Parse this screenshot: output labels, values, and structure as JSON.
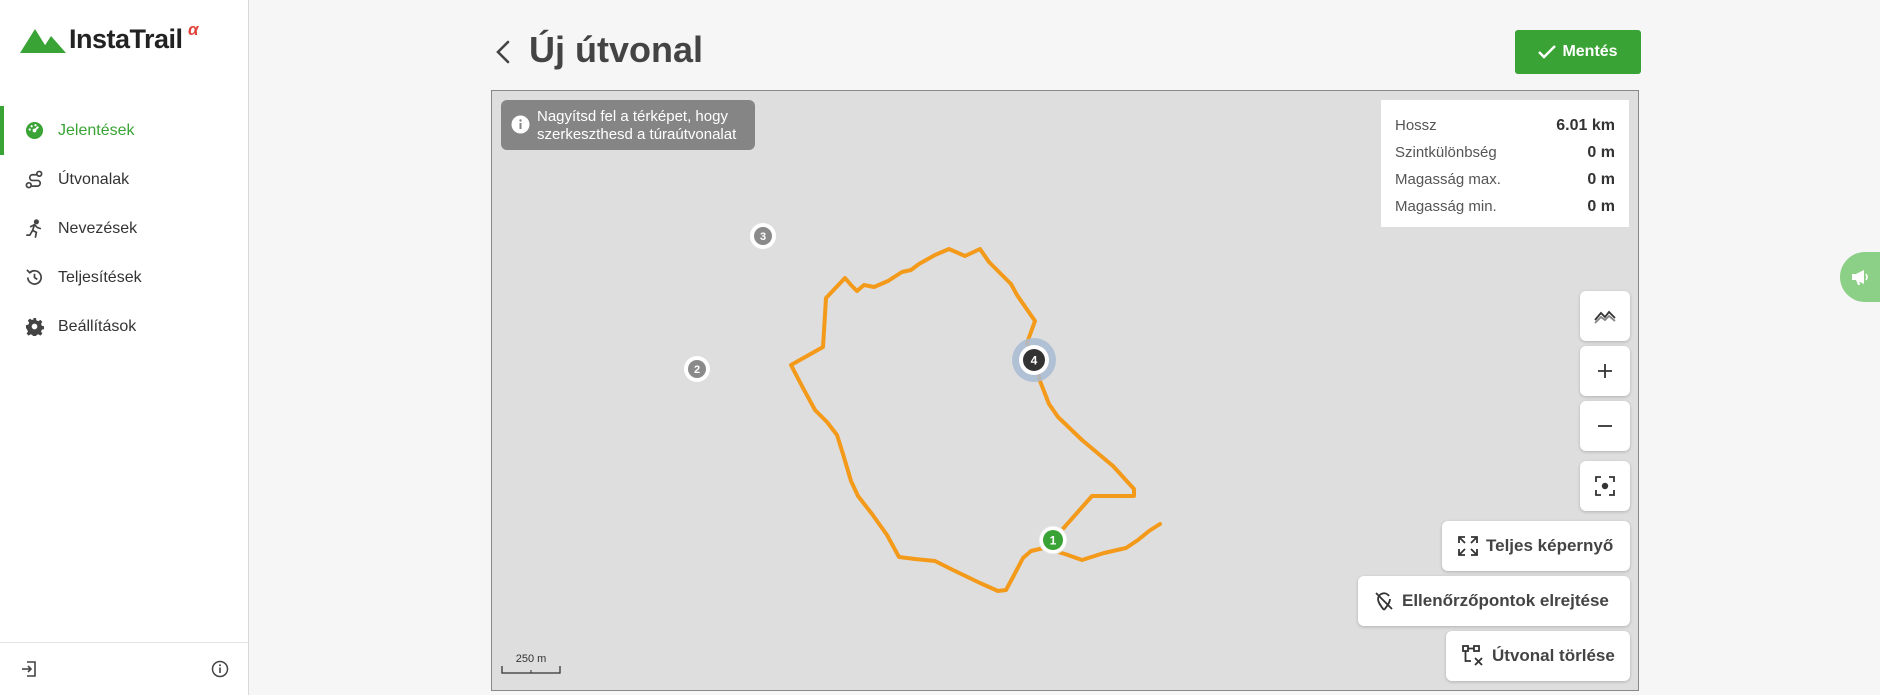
{
  "brand": {
    "name": "InstaTrail",
    "badge": "α",
    "accent": "#3aa335",
    "badge_color": "#e1433a"
  },
  "sidebar": {
    "items": [
      {
        "label": "Jelentések",
        "icon": "dashboard-icon",
        "active": true
      },
      {
        "label": "Útvonalak",
        "icon": "route-icon"
      },
      {
        "label": "Nevezések",
        "icon": "running-icon"
      },
      {
        "label": "Teljesítések",
        "icon": "history-icon"
      },
      {
        "label": "Beállítások",
        "icon": "gear-icon"
      }
    ],
    "bottom": {
      "logout_icon": "logout-icon",
      "info_icon": "info-icon"
    }
  },
  "header": {
    "title": "Új útvonal",
    "save_label": "Mentés",
    "back_icon": "chevron-left-icon"
  },
  "map": {
    "hint": "Nagyítsd fel a térképet, hogy szerkeszthesd a túraútvonalat",
    "stats": [
      {
        "label": "Hossz",
        "value": "6.01 km"
      },
      {
        "label": "Szintkülönbség",
        "value": "0 m"
      },
      {
        "label": "Magasság max.",
        "value": "0 m"
      },
      {
        "label": "Magasság min.",
        "value": "0 m"
      }
    ],
    "controls": {
      "elevation_icon": "elevation-chart-icon",
      "zoom_in_icon": "plus-icon",
      "zoom_out_icon": "minus-icon",
      "locate_icon": "focus-icon",
      "fullscreen_label": "Teljes képernyő",
      "hide_checkpoints_label": "Ellenőrzőpontok elrejtése",
      "delete_route_label": "Útvonal törlése"
    },
    "checkpoints": [
      "1",
      "2",
      "3",
      "4"
    ],
    "scale_label": "250 m",
    "route_color": "#f39a1b"
  },
  "feedback": {
    "icon": "megaphone-icon"
  }
}
